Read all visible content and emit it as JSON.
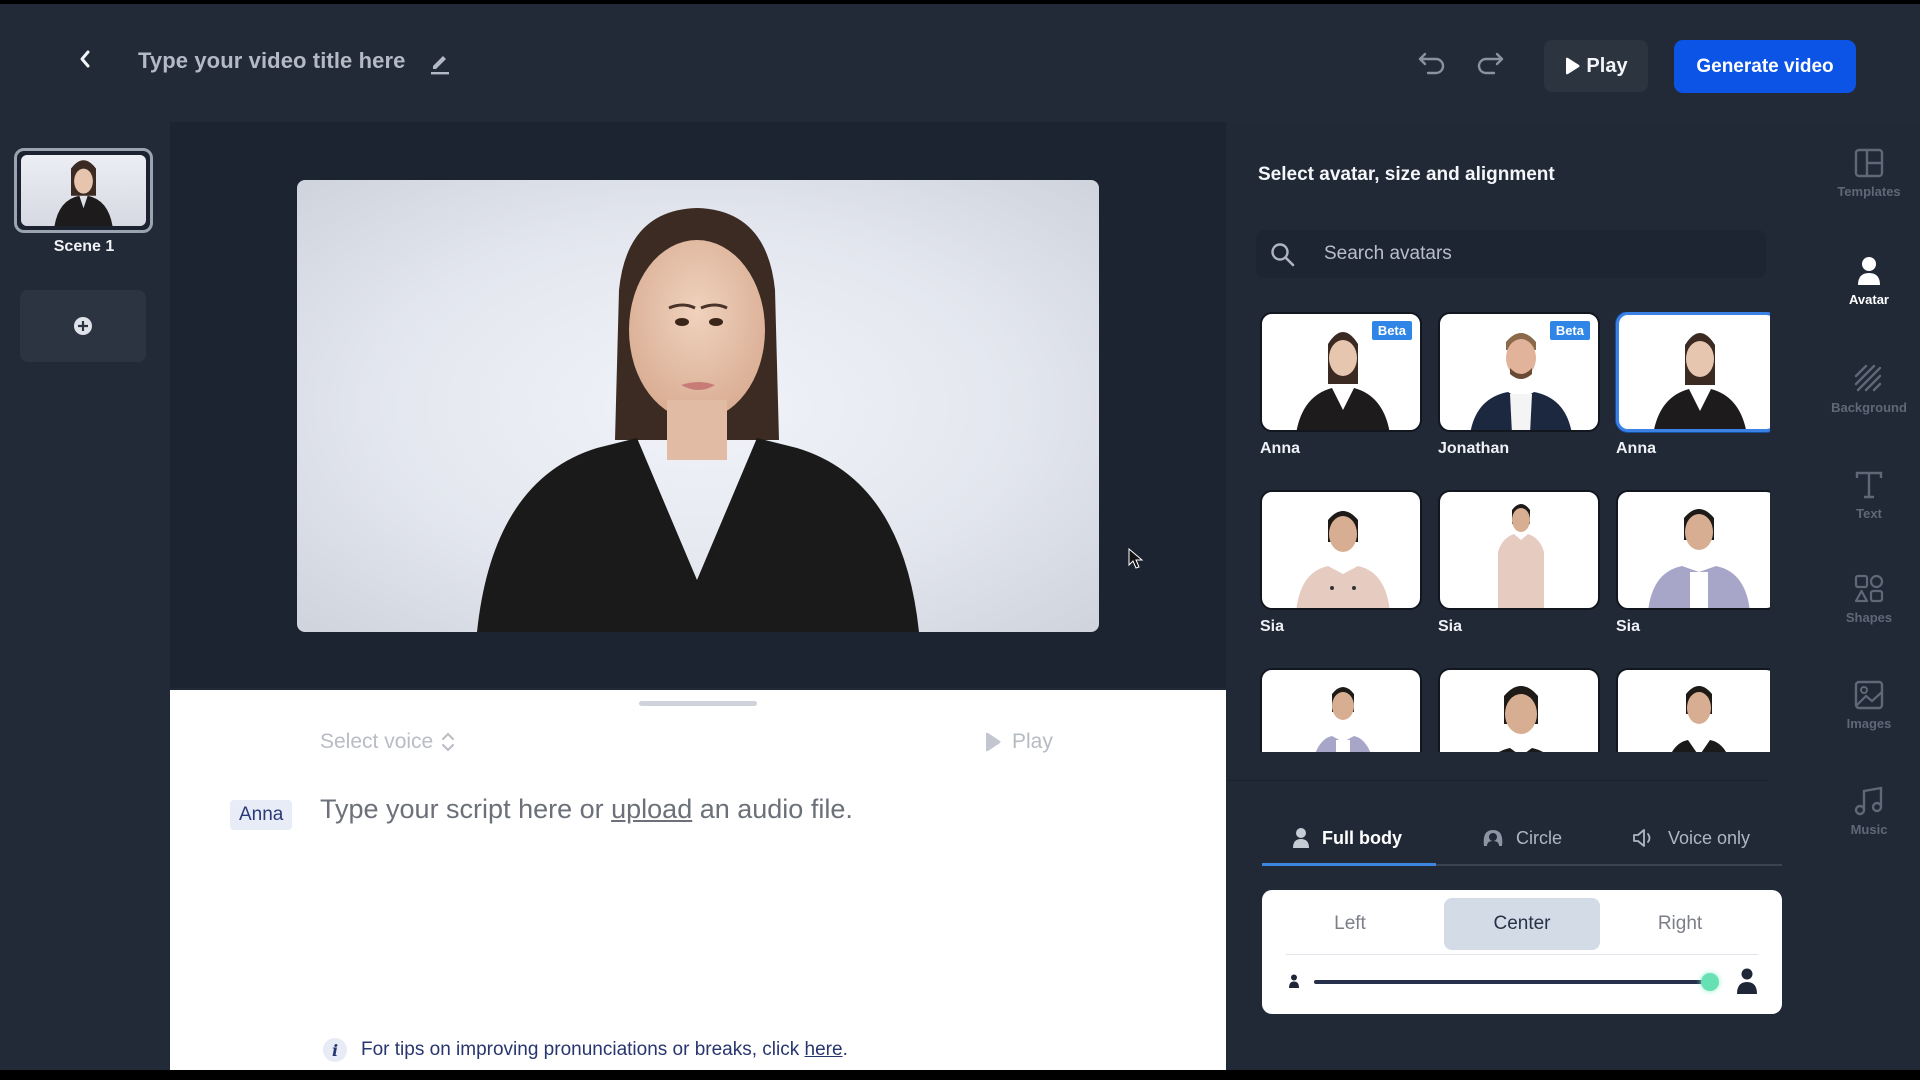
{
  "header": {
    "title": "Type your video title here",
    "play_label": "Play",
    "generate_label": "Generate video"
  },
  "scenes": {
    "items": [
      {
        "label": "Scene 1"
      }
    ]
  },
  "script": {
    "voice_placeholder": "Select voice",
    "play_label": "Play",
    "speaker": "Anna",
    "text_before": "Type your script here or ",
    "text_link": "upload",
    "text_after": " an audio file.",
    "tips_before": "For tips on improving pronunciations or breaks, click ",
    "tips_link": "here",
    "tips_after": "."
  },
  "avatar_panel": {
    "title": "Select avatar, size and alignment",
    "search_placeholder": "Search avatars",
    "avatars": [
      {
        "name": "Anna",
        "badge": "Beta",
        "selected": false
      },
      {
        "name": "Jonathan",
        "badge": "Beta",
        "selected": false
      },
      {
        "name": "Anna",
        "badge": "",
        "selected": true
      },
      {
        "name": "Sia",
        "badge": "",
        "selected": false
      },
      {
        "name": "Sia",
        "badge": "",
        "selected": false
      },
      {
        "name": "Sia",
        "badge": "",
        "selected": false
      },
      {
        "name": "",
        "badge": "",
        "selected": false
      },
      {
        "name": "",
        "badge": "",
        "selected": false
      },
      {
        "name": "",
        "badge": "",
        "selected": false
      }
    ],
    "size_tabs": [
      {
        "label": "Full body",
        "icon": "person-icon",
        "active": true
      },
      {
        "label": "Circle",
        "icon": "circle-avatar-icon",
        "active": false
      },
      {
        "label": "Voice only",
        "icon": "speaker-icon",
        "active": false
      }
    ],
    "alignment": {
      "options": [
        "Left",
        "Center",
        "Right"
      ],
      "selected": "Center"
    },
    "avatar_size_percent": 100
  },
  "tools": [
    {
      "label": "Templates",
      "icon": "templates-icon",
      "active": false
    },
    {
      "label": "Avatar",
      "icon": "avatar-icon",
      "active": true
    },
    {
      "label": "Background",
      "icon": "background-icon",
      "active": false
    },
    {
      "label": "Text",
      "icon": "text-icon",
      "active": false
    },
    {
      "label": "Shapes",
      "icon": "shapes-icon",
      "active": false
    },
    {
      "label": "Images",
      "icon": "images-icon",
      "active": false
    },
    {
      "label": "Music",
      "icon": "music-icon",
      "active": false
    }
  ],
  "colors": {
    "primary": "#0c54e6",
    "accent_tab": "#3d86e0",
    "slider_knob": "#67e0b4",
    "beta_badge": "#2f86e6"
  }
}
